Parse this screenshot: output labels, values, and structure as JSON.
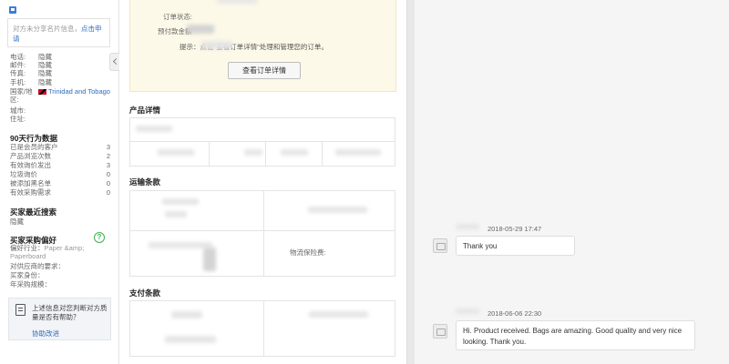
{
  "sidebar": {
    "share_text": "对方未分享名片信息，",
    "share_link": "点击申请",
    "contact": [
      {
        "label": "电话:",
        "value": "隐藏"
      },
      {
        "label": "邮件:",
        "value": "隐藏"
      },
      {
        "label": "传真:",
        "value": "隐藏"
      },
      {
        "label": "手机:",
        "value": "隐藏"
      }
    ],
    "country_label": "国家/地区:",
    "country_value": "Trinidad and Tobago",
    "city_label": "城市:",
    "address_label": "住址:",
    "stats_title": "90天行为数据",
    "stats": [
      {
        "label": "已是会员的客户",
        "value": "3"
      },
      {
        "label": "产品浏览次数",
        "value": "2"
      },
      {
        "label": "有效询价发出",
        "value": "3"
      },
      {
        "label": "垃圾询价",
        "value": "0"
      },
      {
        "label": "被添加黑名单",
        "value": "0"
      },
      {
        "label": "有效采购需求",
        "value": "0"
      }
    ],
    "recent_search_title": "买家最近搜索",
    "recent_search_value": "隐藏",
    "pref_title": "买家采购偏好",
    "pref_industry_label": "偏好行业：",
    "pref_industry_value": "Paper &amp; Paperboard",
    "pref_supplier_label": "对供应商的要求：",
    "pref_identity_label": "买家身份：",
    "pref_volume_label": "年采购规模：",
    "feedback_text": "上述信息对您判断对方质量是否有帮助？",
    "feedback_link": "协助改进"
  },
  "order": {
    "status_label": "订单状态:",
    "prepay_label": "预付款金额",
    "tip_text": "提示：点击\"查看订单详情\"处理和管理您的订单。",
    "view_button": "查看订单详情"
  },
  "sections": {
    "product": "产品详情",
    "shipping": "运输条款",
    "insurance_label": "物流保险费:",
    "payment": "支付条款"
  },
  "chat": {
    "messages": [
      {
        "time": "2018-05-29 17:47",
        "text": "Thank you"
      },
      {
        "time": "2018-06-06 22:30",
        "text": "Hi. Product received. Bags are amazing. Good quality and very nice looking. Thank you."
      }
    ]
  },
  "colors": {
    "link": "#2d6cc0",
    "order_bg": "#fdf9e8",
    "chat_bg": "#f5f5f5",
    "help_green": "#3cb34a"
  }
}
